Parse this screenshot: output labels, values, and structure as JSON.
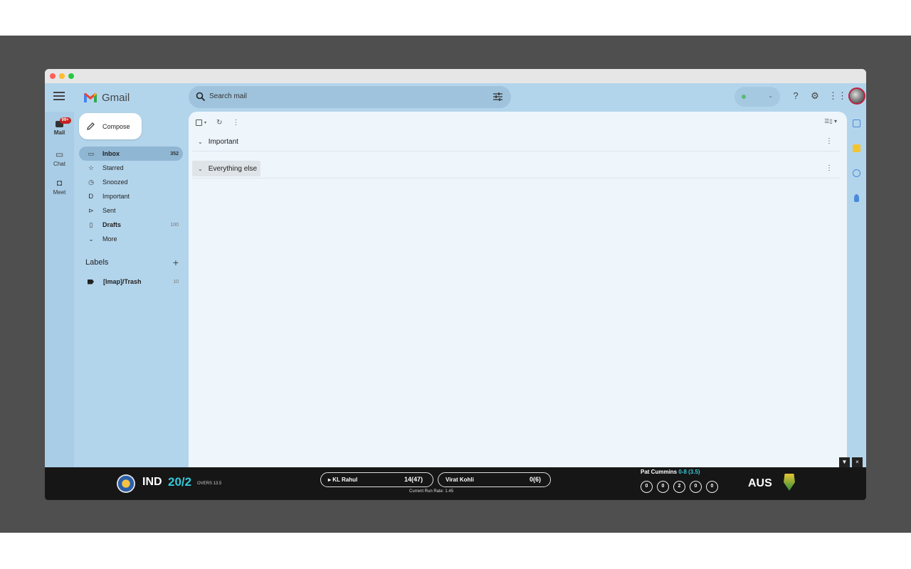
{
  "app": {
    "name": "Gmail"
  },
  "rail": {
    "mail_label": "Mail",
    "mail_badge": "99+",
    "chat_label": "Chat",
    "meet_label": "Meet"
  },
  "search": {
    "placeholder": "Search mail"
  },
  "compose_label": "Compose",
  "nav": [
    {
      "label": "Inbox",
      "count": "352",
      "icon": "inbox-icon"
    },
    {
      "label": "Starred",
      "count": "",
      "icon": "star-icon"
    },
    {
      "label": "Snoozed",
      "count": "",
      "icon": "clock-icon"
    },
    {
      "label": "Important",
      "count": "",
      "icon": "important-icon"
    },
    {
      "label": "Sent",
      "count": "",
      "icon": "send-icon"
    },
    {
      "label": "Drafts",
      "count": "100",
      "icon": "draft-icon"
    },
    {
      "label": "More",
      "count": "",
      "icon": "chevron-down-icon"
    }
  ],
  "labels": {
    "heading": "Labels",
    "items": [
      {
        "label": "[Imap]/Trash",
        "count": "10"
      }
    ]
  },
  "main": {
    "sections": [
      {
        "label": "Important"
      },
      {
        "label": "Everything else"
      }
    ]
  },
  "colors": {
    "background": "#b3d5ec",
    "main_panel": "#eef5fb",
    "accent_score": "#35c8d8"
  },
  "scoreboard": {
    "team_left": "IND",
    "score": "20/2",
    "overs": "OVERS 13.5",
    "batters": [
      {
        "name": "KL Rahul",
        "stat": "14(47)",
        "on_strike": true
      },
      {
        "name": "Virat Kohli",
        "stat": "0(6)",
        "on_strike": false
      }
    ],
    "run_rate": "Current Run Rate: 1.45",
    "bowler_name": "Pat Cummins",
    "bowler_figures": "0-8 (3.5)",
    "balls": [
      "0",
      "0",
      "2",
      "0",
      "0"
    ],
    "team_right": "AUS"
  }
}
